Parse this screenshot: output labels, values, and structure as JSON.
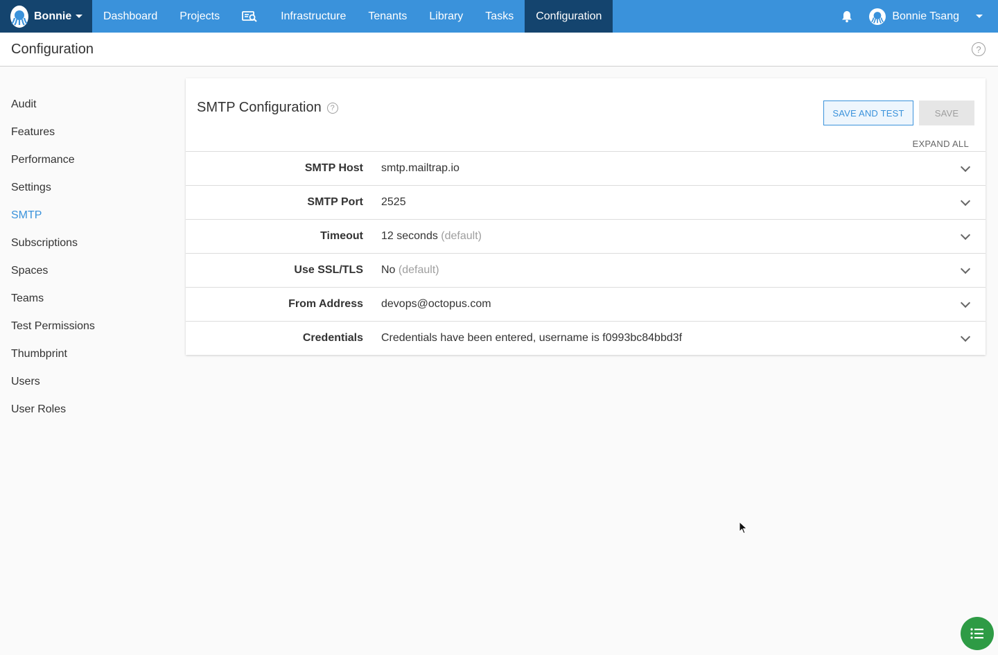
{
  "topnav": {
    "space_name": "Bonnie",
    "items": [
      "Dashboard",
      "Projects",
      "Infrastructure",
      "Tenants",
      "Library",
      "Tasks",
      "Configuration"
    ],
    "active": "Configuration",
    "user_name": "Bonnie Tsang"
  },
  "page": {
    "title": "Configuration"
  },
  "sidebar": {
    "items": [
      "Audit",
      "Features",
      "Performance",
      "Settings",
      "SMTP",
      "Subscriptions",
      "Spaces",
      "Teams",
      "Test Permissions",
      "Thumbprint",
      "Users",
      "User Roles"
    ],
    "active": "SMTP"
  },
  "card": {
    "title": "SMTP Configuration",
    "save_and_test_label": "SAVE AND TEST",
    "save_label": "SAVE",
    "expand_all_label": "EXPAND ALL",
    "rows": [
      {
        "label": "SMTP Host",
        "value": "smtp.mailtrap.io",
        "hint": ""
      },
      {
        "label": "SMTP Port",
        "value": "2525",
        "hint": ""
      },
      {
        "label": "Timeout",
        "value": "12 seconds",
        "hint": "(default)"
      },
      {
        "label": "Use SSL/TLS",
        "value": "No",
        "hint": "(default)"
      },
      {
        "label": "From Address",
        "value": "devops@octopus.com",
        "hint": ""
      },
      {
        "label": "Credentials",
        "value": "Credentials have been entered, username is f0993bc84bbd3f",
        "hint": ""
      }
    ]
  },
  "colors": {
    "nav_blue": "#3a92db",
    "nav_dark": "#14446e",
    "fab_green": "#2e9b45"
  }
}
